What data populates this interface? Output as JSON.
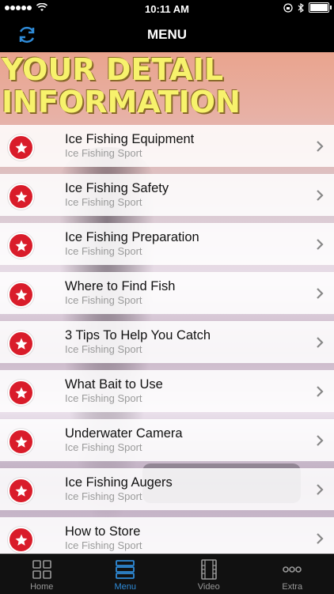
{
  "status_bar": {
    "time": "10:11 AM"
  },
  "nav": {
    "title": "MENU"
  },
  "header": {
    "line1": "YOUR DETAIL",
    "line2": "INFORMATION"
  },
  "items": [
    {
      "title": "Ice Fishing Equipment",
      "subtitle": "Ice Fishing Sport"
    },
    {
      "title": "Ice Fishing Safety",
      "subtitle": "Ice Fishing Sport"
    },
    {
      "title": "Ice Fishing Preparation",
      "subtitle": "Ice Fishing Sport"
    },
    {
      "title": "Where to Find Fish",
      "subtitle": "Ice Fishing Sport"
    },
    {
      "title": "3 Tips To Help You Catch",
      "subtitle": "Ice Fishing Sport"
    },
    {
      "title": "What Bait to Use",
      "subtitle": "Ice Fishing Sport"
    },
    {
      "title": "Underwater Camera",
      "subtitle": "Ice Fishing Sport"
    },
    {
      "title": "Ice Fishing Augers",
      "subtitle": "Ice Fishing Sport"
    },
    {
      "title": "How to Store",
      "subtitle": "Ice Fishing Sport"
    }
  ],
  "tabs": [
    {
      "label": "Home",
      "icon": "grid-icon",
      "active": false
    },
    {
      "label": "Menu",
      "icon": "menu-icon",
      "active": true
    },
    {
      "label": "Video",
      "icon": "film-icon",
      "active": false
    },
    {
      "label": "Extra",
      "icon": "more-icon",
      "active": false
    }
  ],
  "colors": {
    "accent": "#2f8bd8",
    "badge": "#d91c2a",
    "header_text": "#f7f26c"
  }
}
